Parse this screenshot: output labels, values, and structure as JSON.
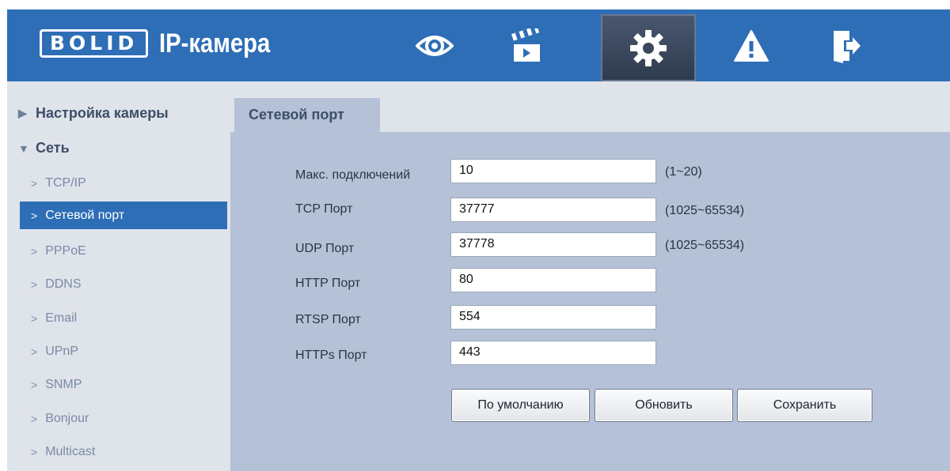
{
  "header": {
    "logo_box": "BOLID",
    "logo_text": "IP-камера",
    "nav": [
      {
        "icon": "eye-icon"
      },
      {
        "icon": "clapperboard-icon"
      },
      {
        "icon": "gear-icon",
        "active": true
      },
      {
        "icon": "warning-icon"
      },
      {
        "icon": "logout-icon"
      }
    ]
  },
  "sidebar": {
    "groups": [
      {
        "label": "Настройка камеры",
        "expanded": false
      },
      {
        "label": "Сеть",
        "expanded": true
      }
    ],
    "items": [
      {
        "label": "TCP/IP"
      },
      {
        "label": "Сетевой порт",
        "active": true
      },
      {
        "label": "PPPoE"
      },
      {
        "label": "DDNS"
      },
      {
        "label": "Email"
      },
      {
        "label": "UPnP"
      },
      {
        "label": "SNMP"
      },
      {
        "label": "Bonjour"
      },
      {
        "label": "Multicast"
      }
    ]
  },
  "main": {
    "tab": "Сетевой порт",
    "fields": [
      {
        "label": "Макс. подключений",
        "value": "10",
        "range": "(1~20)"
      },
      {
        "label": "TCP Порт",
        "value": "37777",
        "range": "(1025~65534)"
      },
      {
        "label": "UDP Порт",
        "value": "37778",
        "range": "(1025~65534)"
      },
      {
        "label": "HTTP Порт",
        "value": "80"
      },
      {
        "label": "RTSP Порт",
        "value": "554"
      },
      {
        "label": "HTTPs Порт",
        "value": "443"
      }
    ],
    "buttons": {
      "default": "По умолчанию",
      "refresh": "Обновить",
      "save": "Сохранить"
    }
  },
  "colors": {
    "header_bg": "#2e6eb6",
    "sidebar_bg": "#dfe3ea",
    "content_bg": "#b4c1d6",
    "active_item": "#2e6eb6"
  }
}
